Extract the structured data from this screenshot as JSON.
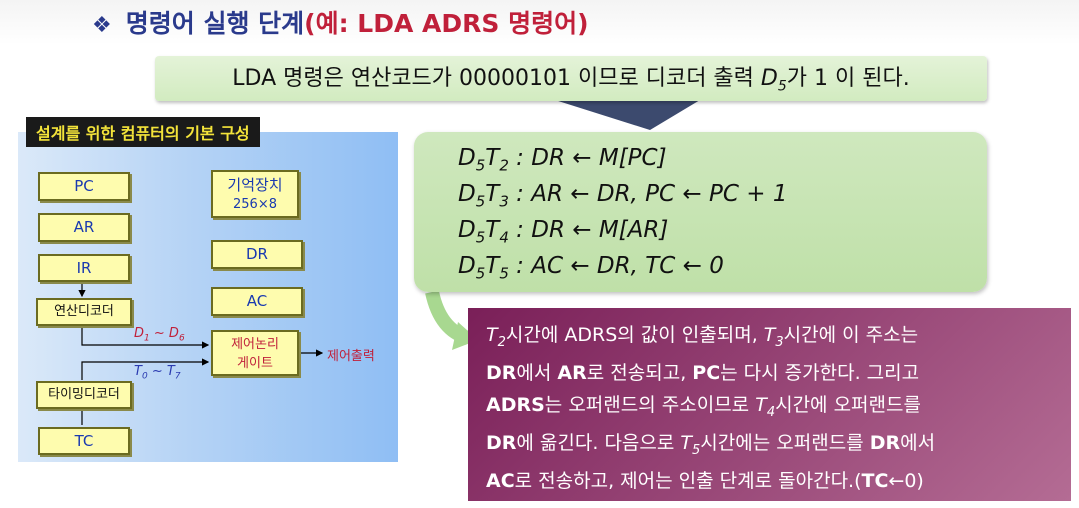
{
  "title": {
    "bullet": "❖",
    "main": "명령어 실행 단계",
    "paren_open": "(",
    "example": "예: LDA ADRS 명령어",
    "paren_close": ")"
  },
  "note": {
    "prefix": "LDA 명령은 연산코드가 00000101 이므로 디코더 출력 ",
    "d_letter": "D",
    "d_sub": "5",
    "suffix": "가 1 이 된다."
  },
  "diagram": {
    "title": "설계를 위한 컴퓨터의 기본 구성",
    "pc": "PC",
    "ar": "AR",
    "ir": "IR",
    "opdecoder": "연산디코더",
    "timingdecoder": "타이밍디코더",
    "tc": "TC",
    "memory_line1": "기억장치",
    "memory_line2": "256×8",
    "dr": "DR",
    "ac": "AC",
    "logic_line1": "제어논리",
    "logic_line2": "게이트",
    "control_out": "제어출력",
    "d_range": {
      "a": "D",
      "a_sub": "1",
      "sep": " ~ ",
      "b": "D",
      "b_sub": "6"
    },
    "t_range": {
      "a": "T",
      "a_sub": "0",
      "sep": " ~ ",
      "b": "T",
      "b_sub": "7"
    }
  },
  "equations": [
    {
      "d": "D",
      "ds": "5",
      "t": "T",
      "ts": "2",
      "rest": " : DR ← M[PC]"
    },
    {
      "d": "D",
      "ds": "5",
      "t": "T",
      "ts": "3",
      "rest": " : AR ← DR,  PC ← PC + 1"
    },
    {
      "d": "D",
      "ds": "5",
      "t": "T",
      "ts": "4",
      "rest": " : DR ← M[AR]"
    },
    {
      "d": "D",
      "ds": "5",
      "t": "T",
      "ts": "5",
      "rest": " : AC ← DR,  TC ← 0"
    }
  ],
  "description": {
    "t2": "T",
    "t2s": "2",
    "p1": "시간에 ADRS의 값이 인출되며, ",
    "t3": "T",
    "t3s": "3",
    "p2": "시간에 이 주소는",
    "dr1": "DR",
    "p3": "에서 ",
    "ar": "AR",
    "p4": "로 전송되고, ",
    "pc": "PC",
    "p5": "는 다시 증가한다. 그리고",
    "adrs": "ADRS",
    "p6": "는 오퍼랜드의 주소이므로  ",
    "t4": "T",
    "t4s": "4",
    "p7": "시간에 오퍼랜드를",
    "dr2": "DR",
    "p8": "에 옮긴다. 다음으로 ",
    "t5": "T",
    "t5s": "5",
    "p9": "시간에는 오퍼랜드를 ",
    "dr3": "DR",
    "p10": "에서",
    "ac": "AC",
    "p11": "로 전송하고, 제어는 인출 단계로 돌아간다.(",
    "tc": "TC",
    "p12": "←0)"
  },
  "colors": {
    "title_blue": "#2a3a8c",
    "title_red": "#c0203a",
    "note_green": "#d8eec8",
    "box_yellow": "#fefcae",
    "desc_purple": "#8a2f66"
  }
}
